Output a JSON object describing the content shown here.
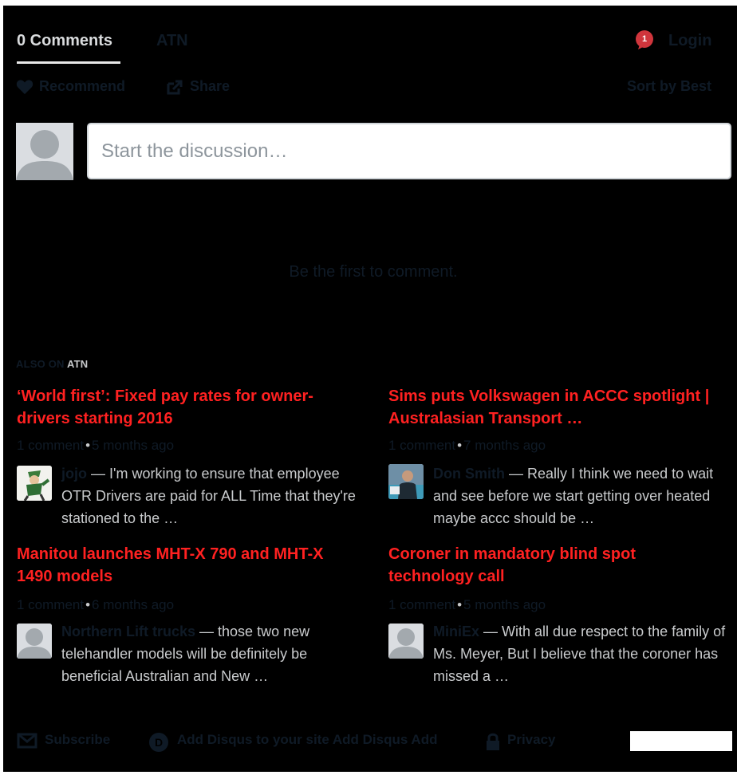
{
  "header": {
    "comments_tab": "0 Comments",
    "site_tab": "ATN",
    "notification_count": "1",
    "login": "Login"
  },
  "toolbar": {
    "recommend": "Recommend",
    "share": "Share",
    "sort": "Sort by Best"
  },
  "composer": {
    "placeholder": "Start the discussion…"
  },
  "empty_state": "Be the first to comment.",
  "also_on": {
    "prefix": "ALSO ON",
    "site": "ATN"
  },
  "discussions": [
    {
      "title": "‘World first’: Fixed pay rates for owner-drivers starting 2016",
      "comments": "1 comment",
      "age": "5 months ago",
      "author": "jojo",
      "avatar": "cartoon-avatar-icon",
      "snippet": "— I'm working to ensure that employee OTR Drivers are paid for ALL Time that they're stationed to the …"
    },
    {
      "title": "Sims puts Volkswagen in ACCC spotlight | Australasian Transport …",
      "comments": "1 comment",
      "age": "7 months ago",
      "author": "Don Smith",
      "avatar": "photo-avatar-icon",
      "snippet": "— Really I think we need to wait and see before we start getting over heated maybe accc should be …"
    },
    {
      "title": "Manitou launches MHT-X 790 and MHT-X 1490 models",
      "comments": "1 comment",
      "age": "6 months ago",
      "author": "Northern Lift trucks",
      "avatar": "default-avatar-icon",
      "snippet": "— those two new telehandler models will be definitely be beneficial Australian and New …"
    },
    {
      "title": "Coroner in mandatory blind spot technology call",
      "comments": "1 comment",
      "age": "5 months ago",
      "author": "MiniEx",
      "avatar": "default-avatar-icon",
      "snippet": "— With all due respect to the family of Ms. Meyer, But I believe that the coroner has missed a …"
    }
  ],
  "footer": {
    "subscribe": "Subscribe",
    "add_disqus": "Add Disqus to your site",
    "add_disqus_short": "Add Disqus Add",
    "privacy": "Privacy"
  },
  "colors": {
    "background": "#000000",
    "title_red": "#ff2121",
    "muted_dark": "#0f1a26",
    "light_text": "#c9cbcd"
  }
}
